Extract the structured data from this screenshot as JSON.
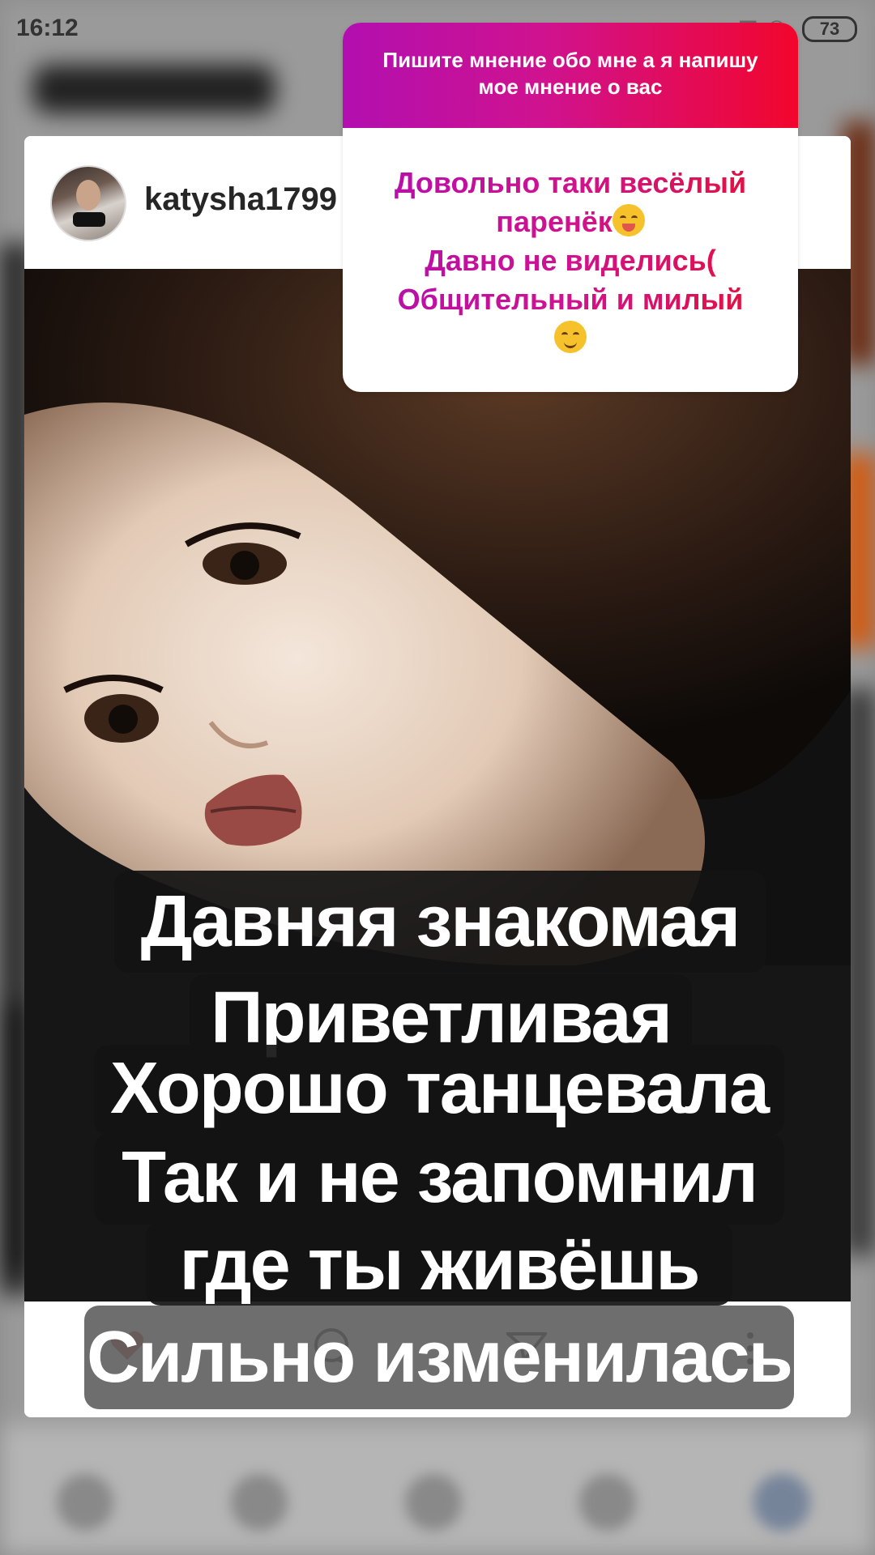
{
  "status_bar": {
    "time": "16:12",
    "battery": "73"
  },
  "post": {
    "username": "katysha1799"
  },
  "question_sticker": {
    "prompt": "Пишите мнение обо мне а я напишу мое мнение о вас",
    "answer_lines": [
      "Довольно таки весёлый",
      "паренёк",
      "Давно не виделись(",
      "Общительный и милый"
    ],
    "colors": {
      "gradient_start": "#b20fb0",
      "gradient_end": "#f2062c"
    }
  },
  "caption": {
    "lines": [
      "Давняя знакомая",
      "Приветливая",
      "Хорошо танцевала",
      "Так и не запомнил",
      "где ты живёшь",
      "Сильно изменилась"
    ]
  },
  "icons": [
    "heart-icon",
    "comment-icon",
    "share-icon",
    "more-icon",
    "home-icon",
    "search-icon",
    "add-icon",
    "activity-icon",
    "profile-icon"
  ]
}
